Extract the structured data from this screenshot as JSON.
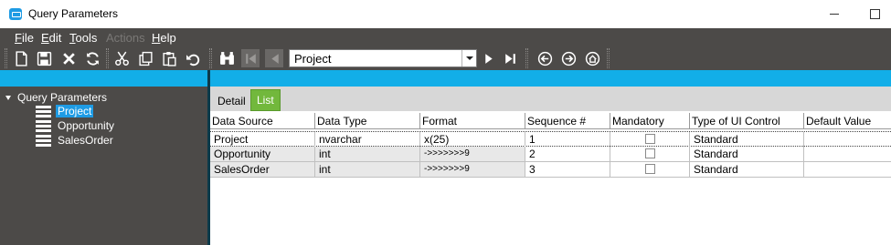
{
  "window": {
    "title": "Query Parameters"
  },
  "menu": [
    {
      "label": "File",
      "key": "F",
      "rest": "ile",
      "disabled": false
    },
    {
      "label": "Edit",
      "key": "E",
      "rest": "dit",
      "disabled": false
    },
    {
      "label": "Tools",
      "key": "T",
      "rest": "ools",
      "disabled": false
    },
    {
      "label": "Actions",
      "key": "",
      "rest": "Actions",
      "disabled": true
    },
    {
      "label": "Help",
      "key": "H",
      "rest": "elp",
      "disabled": false
    }
  ],
  "toolbar": {
    "record_selector": {
      "value": "Project"
    },
    "icons": [
      "new-icon",
      "save-icon",
      "delete-icon",
      "refresh-icon",
      "cut-icon",
      "copy-icon",
      "paste-icon",
      "undo-icon",
      "find-icon",
      "first-record-icon",
      "previous-record-icon",
      "next-record-icon",
      "last-record-icon",
      "back-icon",
      "forward-icon",
      "home-icon"
    ]
  },
  "tree": {
    "root": "Query Parameters",
    "children": [
      {
        "label": "Project",
        "selected": true
      },
      {
        "label": "Opportunity",
        "selected": false
      },
      {
        "label": "SalesOrder",
        "selected": false
      }
    ]
  },
  "tabs": [
    {
      "label": "Detail",
      "active": false
    },
    {
      "label": "List",
      "active": true
    }
  ],
  "grid": {
    "columns": [
      "Data Source",
      "Data Type",
      "Format",
      "Sequence #",
      "Mandatory",
      "Type of UI Control",
      "Default Value"
    ],
    "rows": [
      {
        "data_source": "Project",
        "data_type": "nvarchar",
        "format": "x(25)",
        "sequence": "1",
        "mandatory": false,
        "ui_control": "Standard",
        "default_value": ""
      },
      {
        "data_source": "Opportunity",
        "data_type": "int",
        "format": "->>>>>>>9",
        "sequence": "2",
        "mandatory": false,
        "ui_control": "Standard",
        "default_value": ""
      },
      {
        "data_source": "SalesOrder",
        "data_type": "int",
        "format": "->>>>>>>9",
        "sequence": "3",
        "mandatory": false,
        "ui_control": "Standard",
        "default_value": ""
      }
    ]
  },
  "colors": {
    "accent": "#12aee8",
    "panel": "#4c4a48",
    "active_tab": "#72b83c",
    "selection": "#1e9be4"
  }
}
